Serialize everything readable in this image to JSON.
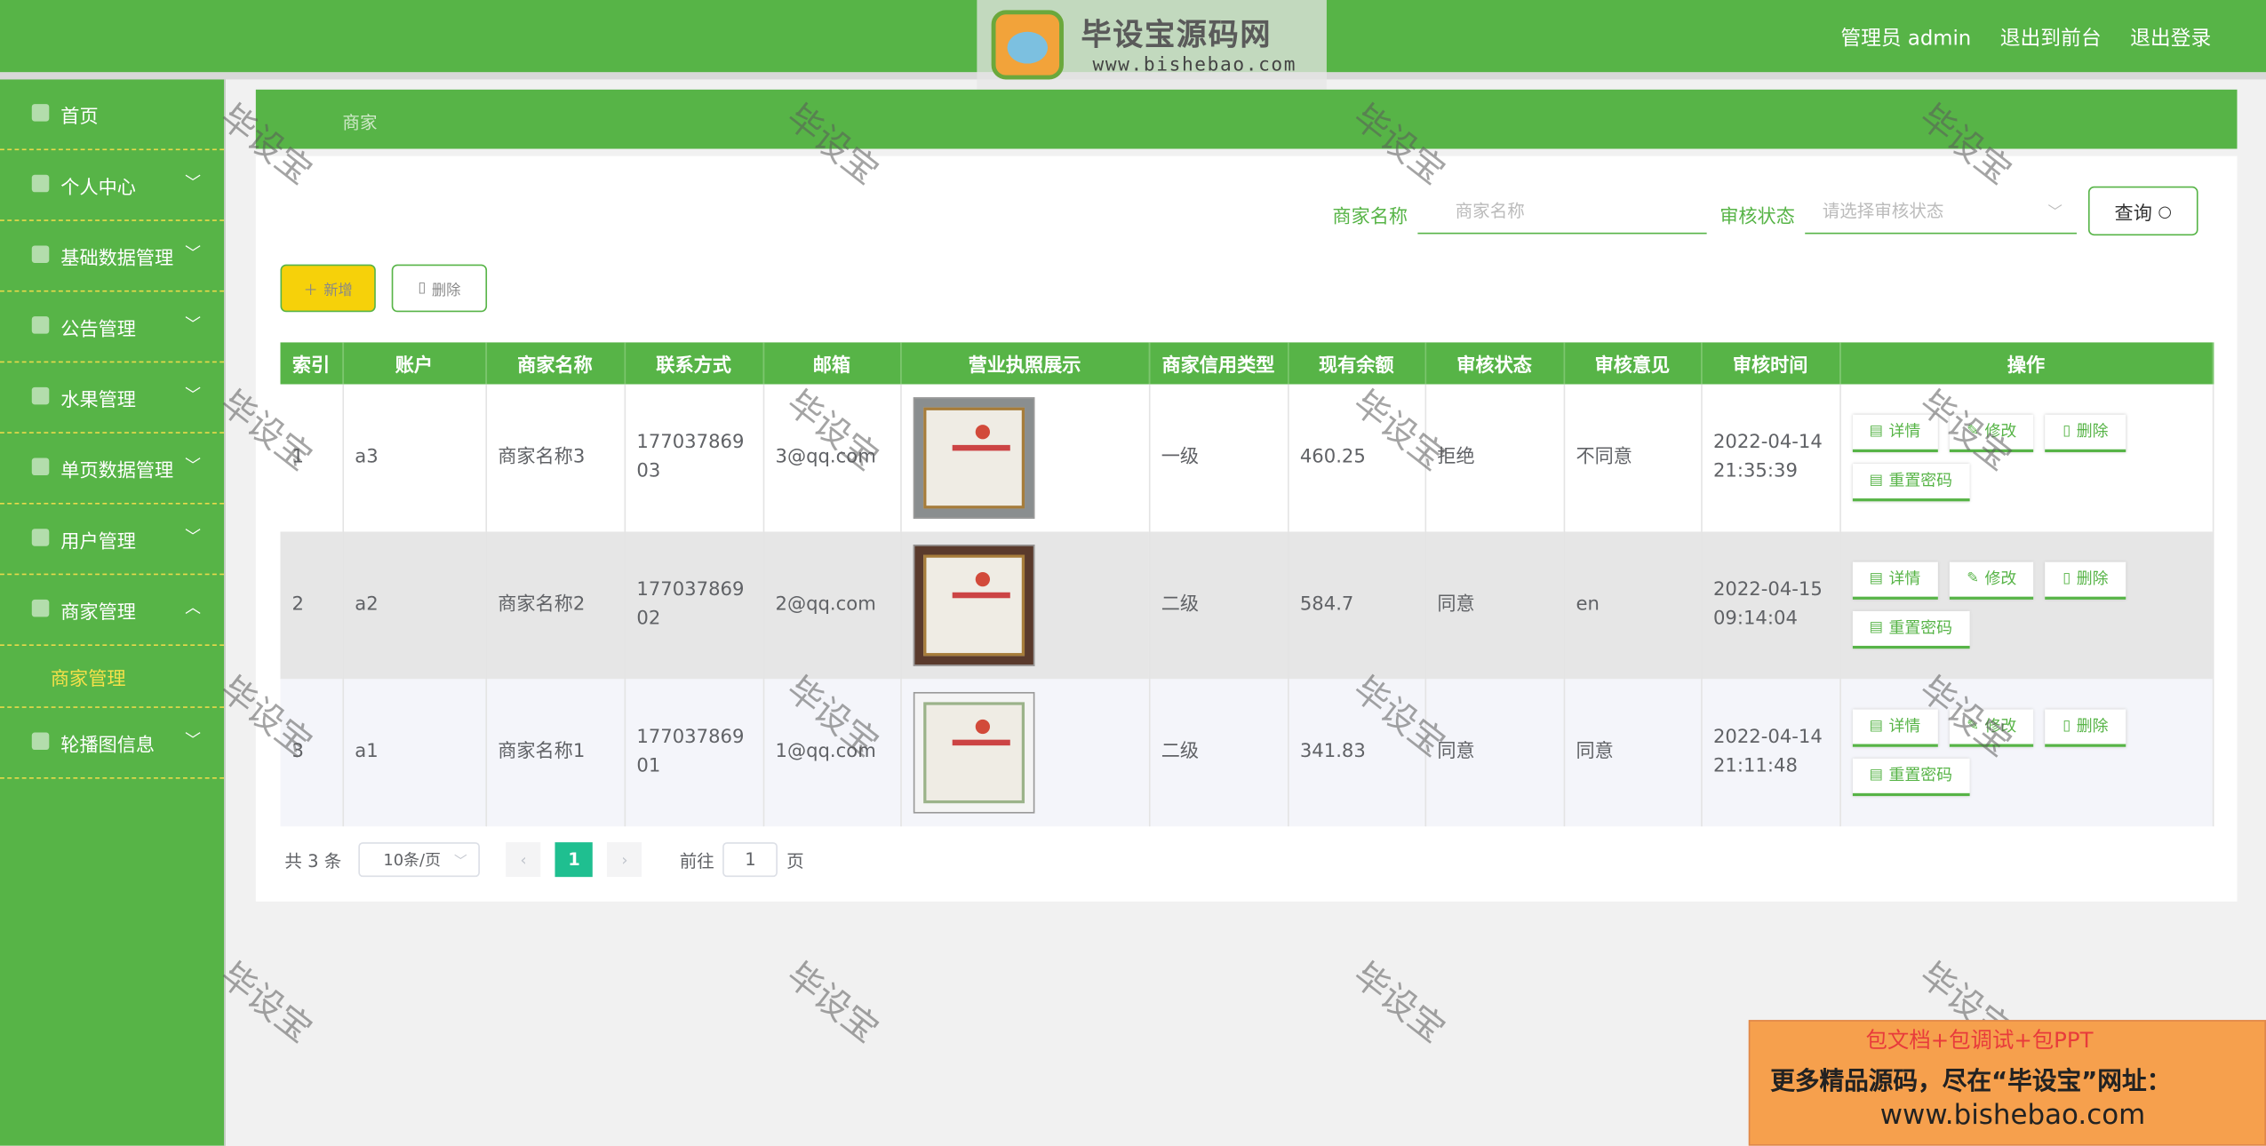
{
  "header": {
    "admin_label": "管理员 admin",
    "to_front": "退出到前台",
    "logout": "退出登录",
    "logo_title": "毕设宝源码网",
    "logo_url": "www.bishebao.com",
    "logo_badge_text": "毕设宝"
  },
  "sidebar": {
    "items": [
      {
        "label": "首页",
        "icon": "home-icon"
      },
      {
        "label": "个人中心",
        "icon": "user-icon"
      },
      {
        "label": "基础数据管理",
        "icon": "list-icon"
      },
      {
        "label": "公告管理",
        "icon": "list-icon"
      },
      {
        "label": "水果管理",
        "icon": "list-icon"
      },
      {
        "label": "单页数据管理",
        "icon": "list-icon"
      },
      {
        "label": "用户管理",
        "icon": "list-icon"
      },
      {
        "label": "商家管理",
        "icon": "shop-icon"
      },
      {
        "label": "轮播图信息",
        "icon": "image-icon"
      }
    ],
    "submenu_label": "商家管理"
  },
  "breadcrumb": {
    "current": "商家"
  },
  "search": {
    "name_label": "商家名称",
    "name_placeholder": "商家名称",
    "status_label": "审核状态",
    "status_placeholder": "请选择审核状态",
    "query_button": "查询"
  },
  "actions": {
    "add": "新增",
    "delete": "删除"
  },
  "table": {
    "headers": [
      "索引",
      "账户",
      "商家名称",
      "联系方式",
      "邮箱",
      "营业执照展示",
      "商家信用类型",
      "现有余额",
      "审核状态",
      "审核意见",
      "审核时间",
      "操作"
    ],
    "rows": [
      {
        "index": "1",
        "account": "a3",
        "name": "商家名称3",
        "phone": "17703786903",
        "email": "3@qq.com",
        "credit": "一级",
        "balance": "460.25",
        "status": "拒绝",
        "opinion": "不同意",
        "time": "2022-04-14 21:35:39"
      },
      {
        "index": "2",
        "account": "a2",
        "name": "商家名称2",
        "phone": "17703786902",
        "email": "2@qq.com",
        "credit": "二级",
        "balance": "584.7",
        "status": "同意",
        "opinion": "en",
        "time": "2022-04-15 09:14:04"
      },
      {
        "index": "3",
        "account": "a1",
        "name": "商家名称1",
        "phone": "17703786901",
        "email": "1@qq.com",
        "credit": "二级",
        "balance": "341.83",
        "status": "同意",
        "opinion": "同意",
        "time": "2022-04-14 21:11:48"
      }
    ],
    "op_labels": {
      "detail": "详情",
      "edit": "修改",
      "delete": "删除",
      "reset": "重置密码"
    }
  },
  "pagination": {
    "total": "共 3 条",
    "page_size": "10条/页",
    "current_page": "1",
    "goto_label": "前往",
    "goto_value": "1",
    "page_suffix": "页"
  },
  "watermark": "毕设宝",
  "ad": {
    "line1": "包文档+包调试+包PPT",
    "line2": "更多精品源码，尽在“毕设宝”网址：",
    "line3": "www.bishebao.com"
  },
  "colors": {
    "primary": "#57b447",
    "accent_yellow": "#f6d10a",
    "page_active": "#1fbf90"
  }
}
